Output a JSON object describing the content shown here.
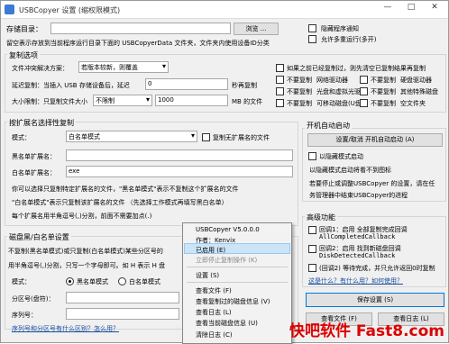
{
  "titlebar": {
    "title": "USBCopyer 设置 (缩权限模式)",
    "min": "—",
    "max": "□",
    "close": "✕"
  },
  "storage": {
    "label": "存储目录：",
    "browse": "浏览 ...",
    "hide_notify": "隐藏程序通知",
    "allow_multi": "允许多重运行(多开)",
    "hint": "留空表示存放到当前程序运行目录下面的 USBCopyerData 文件夹，文件夹内使用设备ID分类"
  },
  "copy_opts": {
    "title": "复制选项",
    "conflict_label": "文件冲突解决方案：",
    "conflict_value": "若版本较新，则覆盖",
    "delay_label": "延迟复制：当插入 USB 存储设备后，延迟",
    "delay_value": "0",
    "delay_unit": "秒再复制",
    "size_label": "大小限制：只复制文件大小",
    "size_select": "不限制",
    "size_value": "1000",
    "size_unit": "MB 的文件",
    "right": {
      "check_prev": "如果之前已经复制过，则先清空已复制结果再复制",
      "no_copy": "不要复制",
      "cols": [
        [
          "网络驱动器",
          "硬盘驱动器"
        ],
        [
          "光盘和虚拟光驱",
          "其他特殊磁盘"
        ],
        [
          "可移动磁盘(U盘)",
          "空文件夹"
        ]
      ]
    }
  },
  "ext_group": {
    "title": "按扩展名选择性复制",
    "mode_label": "模式：",
    "mode_value": "白名单模式",
    "copy_no_ext": "复制无扩展名的文件",
    "black_label": "黑名单扩展名：",
    "black_value": "",
    "white_label": "白名单扩展名：",
    "white_value": "exe",
    "desc1": "你可以选择只复制特定扩展名的文件，\"黑名单模式\"表示不复制这个扩展名的文件",
    "desc2": "\"白名单模式\"表示只复制该扩展名的文件 （先选择工作模式再填写黑白名单）",
    "desc3": "每个扩展名用半角逗号(,)分割，前面不需要加点(.)"
  },
  "disk_group": {
    "title": "磁盘黑/白名单设置",
    "desc1": "不复制(黑名单模式)或只复制(白名单模式)某些分区号的",
    "desc2": "用半角逗号(,)分割，只写一个字母即可。如 H 表示 H 盘",
    "mode_label": "模式：",
    "black_mode": "黑名单模式",
    "white_mode": "白名单模式",
    "part_label": "分区号(盘符)：",
    "part_value": "",
    "serial_label": "序列号：",
    "serial_value": "",
    "link": "序列号和分区号有什么区别？怎么用？"
  },
  "startup": {
    "title": "开机自动启动",
    "toggle_btn": "设置/取消 开机自动启动 (A)",
    "hidden_mode": "以隐藏模式启动",
    "d1": "以隐藏模式启动将看不到图标",
    "d2": "若要停止或调整USBCopyer 的设置，请在任",
    "d3": "务管理器中结束USBCopyer的进程"
  },
  "advanced": {
    "title": "高级功能",
    "cb1a": "回调1：启用 全部复制完成回调",
    "cb1b": "AllCompletedCallback",
    "cb2a": "回调2：启用 找到新磁盘回调",
    "cb2b": "DiskDetectedCallback",
    "cb3": "(回调2) 等待完成，并只允许返回0时复制",
    "link": "这是什么？有什么用？如何使用？"
  },
  "save_btn": "保存设置 (S)",
  "view_file_btn": "查看文件 (F)",
  "view_log_btn": "查看日志 (L)",
  "menu": {
    "header": "USBCopyer V5.0.0.0",
    "author": "作者：Kenvix",
    "enabled": "已启用 (E)",
    "stop_now": "立即停止复制操作 (K)",
    "settings": "设置 (S)",
    "view_file": "查看文件 (F)",
    "view_copied": "查看复制过的磁盘信息 (V)",
    "view_log": "查看日志 (L)",
    "view_current": "查看当前磁盘信息 (U)",
    "clear_log": "清除日志 (C)"
  },
  "watermark": "快吧软件 Fast8.com"
}
